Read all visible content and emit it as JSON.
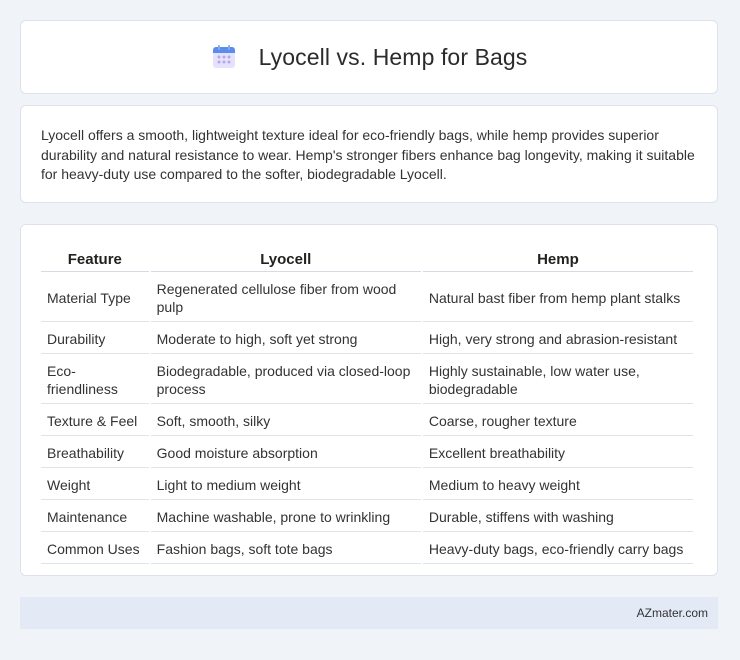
{
  "header": {
    "title": "Lyocell vs. Hemp for Bags",
    "icon": "calendar-icon"
  },
  "summary": {
    "text": "Lyocell offers a smooth, lightweight texture ideal for eco-friendly bags, while hemp provides superior durability and natural resistance to wear. Hemp's stronger fibers enhance bag longevity, making it suitable for heavy-duty use compared to the softer, biodegradable Lyocell."
  },
  "table": {
    "headers": [
      "Feature",
      "Lyocell",
      "Hemp"
    ],
    "rows": [
      [
        "Material Type",
        "Regenerated cellulose fiber from wood pulp",
        "Natural bast fiber from hemp plant stalks"
      ],
      [
        "Durability",
        "Moderate to high, soft yet strong",
        "High, very strong and abrasion-resistant"
      ],
      [
        "Eco-friendliness",
        "Biodegradable, produced via closed-loop process",
        "Highly sustainable, low water use, biodegradable"
      ],
      [
        "Texture & Feel",
        "Soft, smooth, silky",
        "Coarse, rougher texture"
      ],
      [
        "Breathability",
        "Good moisture absorption",
        "Excellent breathability"
      ],
      [
        "Weight",
        "Light to medium weight",
        "Medium to heavy weight"
      ],
      [
        "Maintenance",
        "Machine washable, prone to wrinkling",
        "Durable, stiffens with washing"
      ],
      [
        "Common Uses",
        "Fashion bags, soft tote bags",
        "Heavy-duty bags, eco-friendly carry bags"
      ]
    ]
  },
  "footer": {
    "brand": "AZmater.com"
  },
  "colors": {
    "background": "#f0f3f8",
    "card": "#ffffff",
    "footer_bg": "#e3eaf6",
    "icon_blue": "#5b8def",
    "icon_purple": "#b9a4f0"
  }
}
